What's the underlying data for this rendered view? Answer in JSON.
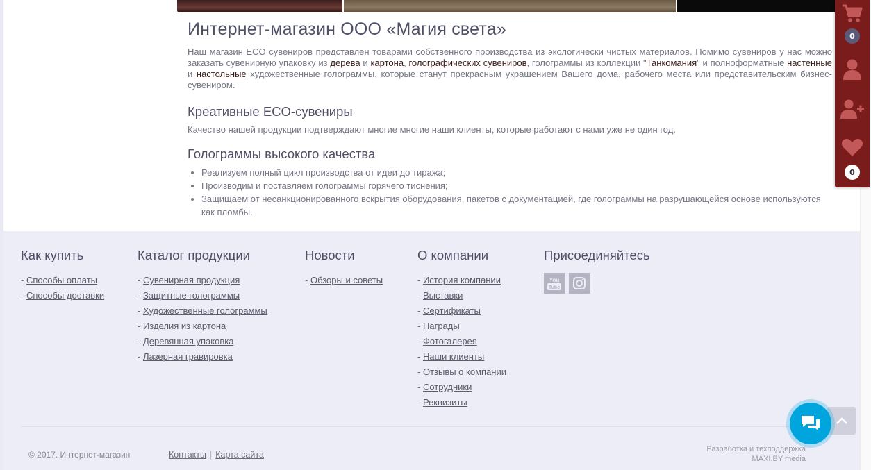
{
  "main": {
    "title": "Интернет-магазин ООО «Магия света»",
    "intro": {
      "t1": "Наш магазин ECO сувениров представлен товарами собственного производства из экологически чистых материалов. Помимо сувениров у нас можно заказать сувенирную упаковку из ",
      "link_wood": "дерева",
      "t2": " и ",
      "link_carton": "картона",
      "t3": ", ",
      "link_holo_souvenirs": "голографических сувениров",
      "t4": ", голограммы из коллекции \"",
      "link_tankomania": "Танкомания",
      "t5": "\" и полноформатные ",
      "link_wall": "настенные",
      "t6": " и ",
      "link_desk": "настольные",
      "t7": " художественные голограммы, которые станут прекрасным украшением Вашего дома, рабочего места или представительским бизнес-сувениром."
    },
    "eco_heading": "Креативные ECO-сувениры",
    "eco_text": "Качество нашей продукции подтверждают многие многие наши клиенты, которые работают с нами уже не один год.",
    "holo_heading": "Голограммы высокого качества",
    "holo_list": [
      "Реализуем полный цикл производства от идеи до тиража;",
      "Производим и поставляем голограммы горячего тиснения;",
      "Защищаем от несанкционированного вскрытия оборудования, пакетов с документацией, где голограммы на разрушающейся основе используются как пломбы."
    ]
  },
  "footer": {
    "how_to_buy": {
      "title": "Как купить",
      "items": [
        "Способы оплаты",
        "Способы доставки"
      ]
    },
    "catalog": {
      "title": "Каталог продукции",
      "items": [
        "Сувенирная продукция",
        "Защитные голограммы",
        "Художественные голограммы",
        "Изделия из картона",
        "Деревянная упаковка",
        "Лазерная гравировка"
      ]
    },
    "news": {
      "title": "Новости",
      "items": [
        "Обзоры и советы"
      ]
    },
    "about": {
      "title": "О компании",
      "items": [
        "История компании",
        "Выставки",
        "Сертификаты",
        "Награды",
        "Фотогалерея",
        "Наши клиенты",
        "Отзывы о компании",
        "Сотрудники",
        "Реквизиты"
      ]
    },
    "join": {
      "title": "Присоединяйтесь",
      "youtube_label": "You Tube"
    },
    "copyright": "© 2017. Интернет-магазин",
    "contacts_link": "Контакты",
    "sitemap_link": "Карта сайта",
    "dev_line1": "Разработка и техподдержка",
    "dev_line2": "MAXI.BY media"
  },
  "sidebar": {
    "cart_count": "0",
    "favorites_count": "0"
  },
  "colors": {
    "sidebar_bg": "#7b1c1c",
    "chat_accent": "#00a5de",
    "heading": "#4f4f66",
    "footer_bg": "#ededf7"
  }
}
